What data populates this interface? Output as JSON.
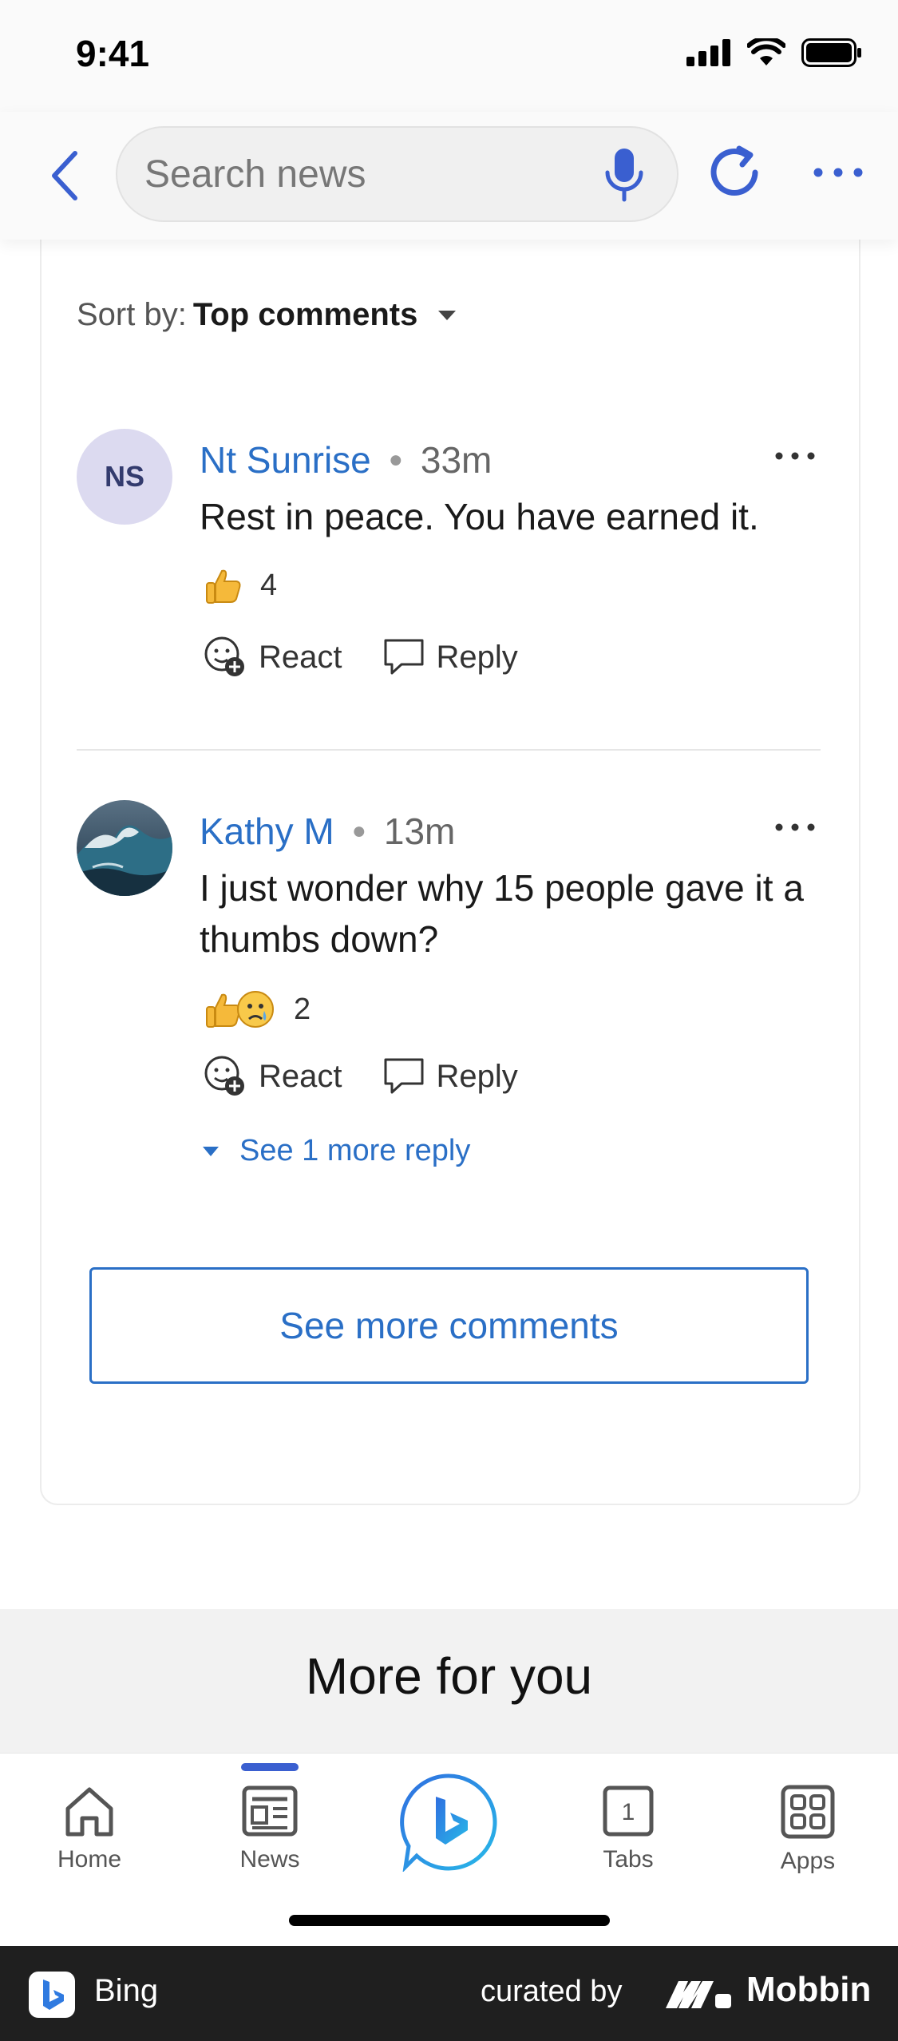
{
  "status_bar": {
    "time": "9:41"
  },
  "nav": {
    "search_placeholder": "Search news"
  },
  "sort": {
    "label": "Sort by:",
    "value": "Top comments"
  },
  "comments": [
    {
      "author": "Nt Sunrise",
      "initials": "NS",
      "time": "33m",
      "text": "Rest in peace.  You have earned it.",
      "reaction_count": "4",
      "react_label": "React",
      "reply_label": "Reply"
    },
    {
      "author": "Kathy M",
      "time": "13m",
      "text": "I just wonder why 15 people gave it a thumbs down?",
      "reaction_count": "2",
      "react_label": "React",
      "reply_label": "Reply",
      "more_replies": "See 1 more reply"
    }
  ],
  "see_more_label": "See more comments",
  "more_for_you": "More for you",
  "tabs": [
    {
      "label": "Home",
      "icon": "home-icon"
    },
    {
      "label": "News",
      "icon": "news-icon",
      "active": true
    },
    {
      "label": "",
      "icon": "bing-chat-icon"
    },
    {
      "label": "Tabs",
      "icon": "tabs-icon",
      "count": "1"
    },
    {
      "label": "Apps",
      "icon": "apps-icon"
    }
  ],
  "footer": {
    "app_name": "Bing",
    "curated": "curated by",
    "brand": "Mobbin"
  },
  "colors": {
    "accent": "#2a6fc6",
    "nav_icon": "#3a5fd0",
    "avatar_bg": "#dcdaf0"
  }
}
